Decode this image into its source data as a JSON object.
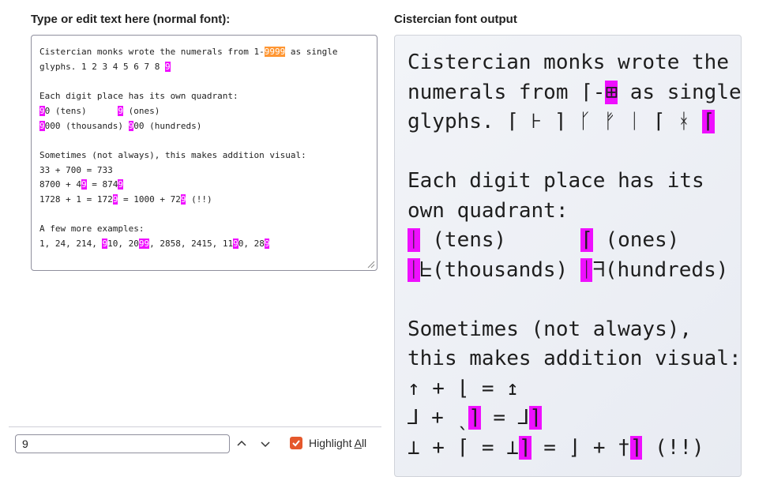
{
  "left_panel": {
    "label": "Type or edit text here (normal font):",
    "lines": [
      [
        "Cistercian monks wrote the numerals from 1-",
        {
          "h": "9999",
          "cur": true
        },
        " as single"
      ],
      [
        "glyphs. 1 2 3 4 5 6 7 8 ",
        {
          "h": "9"
        }
      ],
      [
        ""
      ],
      [
        "Each digit place has its own quadrant:"
      ],
      [
        {
          "h": "9"
        },
        "0 (tens)      ",
        {
          "h": "9"
        },
        " (ones)"
      ],
      [
        {
          "h": "9"
        },
        "000 (thousands) ",
        {
          "h": "9"
        },
        "00 (hundreds)"
      ],
      [
        ""
      ],
      [
        "Sometimes (not always), this makes addition visual:"
      ],
      [
        "33 + 700 = 733"
      ],
      [
        "8700 + 4",
        {
          "h": "9"
        },
        " = 874",
        {
          "h": "9"
        }
      ],
      [
        "1728 + 1 = 172",
        {
          "h": "9"
        },
        " = 1000 + 72",
        {
          "h": "9"
        },
        " (!!)"
      ],
      [
        ""
      ],
      [
        "A few more examples:"
      ],
      [
        "1, 24, 214, ",
        {
          "h": "9"
        },
        "10, 20",
        {
          "h": "99"
        },
        ", 2858, 2415, 11",
        {
          "h": "9"
        },
        "0, 28",
        {
          "h": "9"
        }
      ]
    ]
  },
  "right_panel": {
    "label": "Cistercian font output",
    "lines": [
      [
        "Cistercian monks wrote the"
      ],
      [
        "numerals from ⌈-",
        {
          "h": "⊞"
        },
        " as single"
      ],
      [
        "glyphs. ⌈ ⊦ ⌉ ᚴ ᚠ ᛁ ⌈ ᚼ ",
        {
          "h": "⌈"
        }
      ],
      [
        ""
      ],
      [
        "Each digit place has its"
      ],
      [
        "own quadrant:"
      ],
      [
        {
          "h": "ᛁ"
        },
        " (tens)      ",
        {
          "h": "⌈"
        },
        " (ones)"
      ],
      [
        {
          "h": "ᛁ"
        },
        "ᖶ(thousands) ",
        {
          "h": "ᛁ"
        },
        "ᖷ(hundreds)"
      ],
      [
        ""
      ],
      [
        "Sometimes (not always),"
      ],
      [
        "this makes addition visual:"
      ],
      [
        "↑ + ⌊ = ↥"
      ],
      [
        "⅃ + ˎ",
        {
          "h": "⌉"
        },
        " = ⅃",
        {
          "h": "⌉"
        }
      ],
      [
        "⊥ + ⌈ = ⊥",
        {
          "h": "⌉"
        },
        " = ⌋ + †",
        {
          "h": "⌉"
        },
        " (!!)"
      ]
    ]
  },
  "find_bar": {
    "query": "9",
    "highlight_all_label_pre": "Highlight ",
    "highlight_all_label_accel": "A",
    "highlight_all_label_post": "ll",
    "highlight_all_checked": true
  },
  "colors": {
    "highlight": "#ef0fff",
    "current_match": "#ff9632",
    "checkbox": "#e5582c"
  }
}
